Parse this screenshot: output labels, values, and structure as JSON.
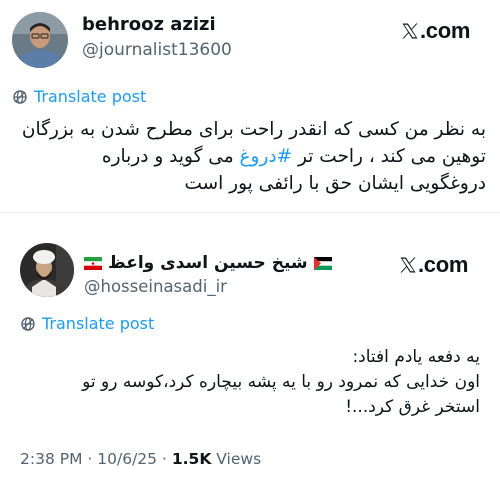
{
  "tweet1": {
    "display_name": "behrooz azizi",
    "handle": "@journalist13600",
    "brand": ".com",
    "translate_label": "Translate post",
    "text_line1": "به نظر من کسی که انقدر راحت برای مطرح شدن به بزرگان",
    "text_line2_before": "توهین می کند ، راحت تر ",
    "text_line2_hashtag": "#دروغ",
    "text_line2_after": " می گوید و درباره",
    "text_line3": "دروغگویی ایشان حق با رائفی پور است"
  },
  "tweet2": {
    "display_name": "شیخ حسین اسدی واعظ",
    "handle": "@hosseinasadi_ir",
    "brand": ".com",
    "translate_label": "Translate post",
    "text_line1": "یه دفعه یادم افتاد:",
    "text_line2": "اون خدایی که نمرود رو با یه پشه بیچاره کرد،کوسه رو تو",
    "text_line3": "استخر غرق کرد...!",
    "time": "2:38 PM",
    "separator": "·",
    "date": "10/6/25",
    "views_count": "1.5K",
    "views_label": "Views"
  },
  "icons": {
    "translate": "globe-icon",
    "brand": "x-logo-icon",
    "flag_iran": "iran-flag-icon",
    "flag_palestine": "palestine-flag-icon"
  },
  "colors": {
    "link": "#1d9bf0",
    "secondary": "#536471",
    "text": "#0f1419"
  }
}
